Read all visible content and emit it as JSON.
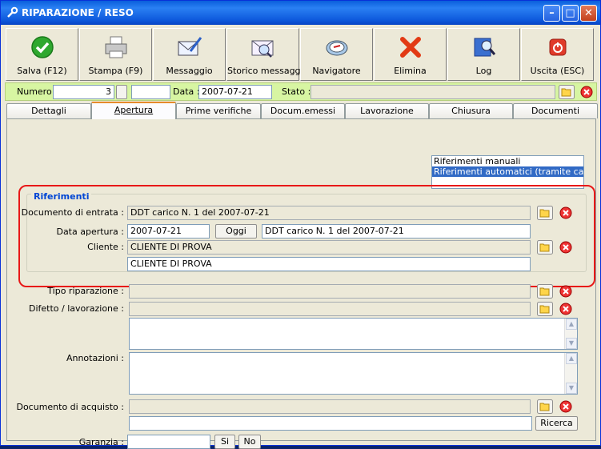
{
  "window": {
    "title": "RIPARAZIONE / RESO"
  },
  "toolbar": [
    {
      "label": "Salva (F12)",
      "icon": "check-icon"
    },
    {
      "label": "Stampa (F9)",
      "icon": "printer-icon"
    },
    {
      "label": "Messaggio",
      "icon": "envelope-pen-icon"
    },
    {
      "label": "Storico messaggi",
      "icon": "envelope-search-icon"
    },
    {
      "label": "Navigatore",
      "icon": "compass-icon"
    },
    {
      "label": "Elimina",
      "icon": "delete-x-icon"
    },
    {
      "label": "Log",
      "icon": "book-search-icon"
    },
    {
      "label": "Uscita (ESC)",
      "icon": "power-icon"
    }
  ],
  "header": {
    "numero_label": "Numero :",
    "numero_value": "3",
    "numero_suffix": "",
    "data_label": "Data :",
    "data_value": "2007-07-21",
    "stato_label": "Stato :",
    "stato_value": ""
  },
  "tabs": [
    {
      "label": "Dettagli"
    },
    {
      "label": "Apertura",
      "active": true
    },
    {
      "label": "Prime verifiche"
    },
    {
      "label": "Docum.emessi"
    },
    {
      "label": "Lavorazione"
    },
    {
      "label": "Chiusura"
    },
    {
      "label": "Documenti"
    }
  ],
  "riferimenti_list": [
    "Riferimenti manuali",
    "Riferimenti automatici (tramite causali ab"
  ],
  "riferimenti": {
    "title": "Riferimenti",
    "documento_entrata_label": "Documento di entrata :",
    "documento_entrata_value": "DDT carico N. 1 del 2007-07-21",
    "data_apertura_label": "Data apertura :",
    "data_apertura_value": "2007-07-21",
    "oggi_label": "Oggi",
    "data_apertura_doc": "DDT carico N. 1 del 2007-07-21",
    "cliente_label": "Cliente :",
    "cliente_value": "CLIENTE DI PROVA",
    "cliente_value2": "CLIENTE DI PROVA"
  },
  "form": {
    "tipo_riparazione_label": "Tipo riparazione :",
    "tipo_riparazione_value": "",
    "difetto_label": "Difetto / lavorazione :",
    "difetto_value": "",
    "annotazioni_label": "Annotazioni :",
    "documento_acquisto_label": "Documento di acquisto :",
    "documento_acquisto_value": "",
    "ricerca_label": "Ricerca",
    "garanzia_label": "Garanzia :",
    "garanzia_value": "",
    "si_label": "Si",
    "no_label": "No"
  }
}
